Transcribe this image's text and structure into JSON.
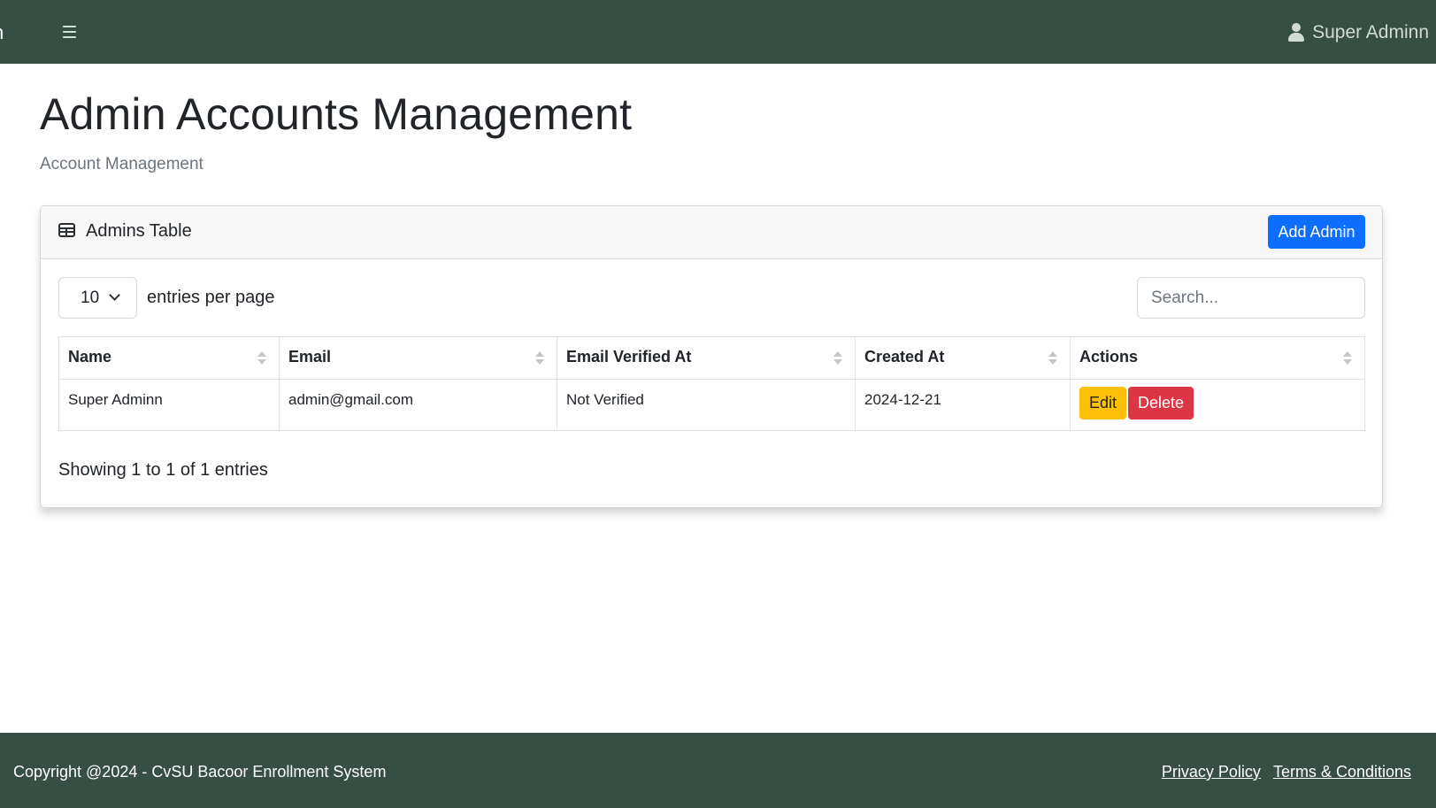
{
  "navbar": {
    "brand_fragment": "n",
    "menu_icon": "hamburger-icon",
    "user_icon": "user-icon",
    "user_name": "Super Adminn"
  },
  "page": {
    "title": "Admin Accounts Management",
    "breadcrumb": "Account Management"
  },
  "card": {
    "icon": "table-icon",
    "title": "Admins Table",
    "add_button": "Add Admin",
    "entries_value": "10",
    "entries_label": "entries per page",
    "search_placeholder": "Search...",
    "columns": [
      "Name",
      "Email",
      "Email Verified At",
      "Created At",
      "Actions"
    ],
    "rows": [
      {
        "name": "Super Adminn",
        "email": "admin@gmail.com",
        "verified": "Not Verified",
        "created": "2024-12-21",
        "edit_label": "Edit",
        "delete_label": "Delete"
      }
    ],
    "info": "Showing 1 to 1 of 1 entries"
  },
  "footer": {
    "copyright": "Copyright @2024 - CvSU Bacoor Enrollment System",
    "privacy": "Privacy Policy",
    "terms": "Terms & Conditions"
  },
  "colors": {
    "navbar": "#354f44",
    "primary": "#0d6efd",
    "warning": "#ffc107",
    "danger": "#dc3545"
  }
}
